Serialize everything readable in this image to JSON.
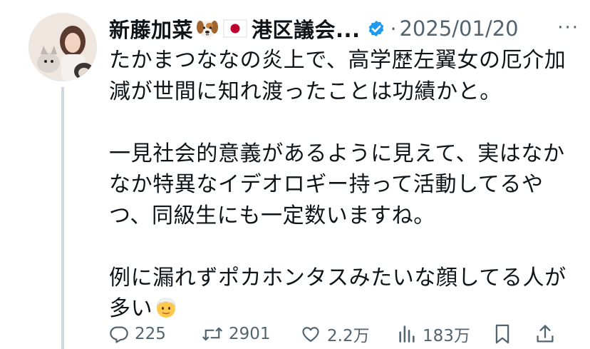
{
  "post": {
    "author_name": "新藤加菜",
    "author_suffix": "港区議会...",
    "separator": "·",
    "date": "2025/01/20",
    "more": "···",
    "paragraphs": [
      "たかまつななの炎上で、高学歴左翼女の厄介加\n減が世間に知れ渡ったことは功績かと。",
      "一見社会的意義があるように見えて、実はなか\nなか特異なイデオロギー持って活動してるや\nつ、同級生にも一定数いますね。",
      "例に漏れずポカホンタスみたいな顔してる人が\n多い"
    ]
  },
  "icons": {
    "emoji_after_name": "dog-face-icon",
    "flag": "japan-flag-icon",
    "verified": "verified-badge-icon",
    "emoji_end": "older-person-icon"
  },
  "actions": {
    "replies": "225",
    "reposts": "2901",
    "likes": "2.2万",
    "views": "183万"
  },
  "colors": {
    "text": "#0f1419",
    "secondary": "#536471",
    "verified": "#1d9bf0",
    "thread_line": "#cfd9de"
  }
}
